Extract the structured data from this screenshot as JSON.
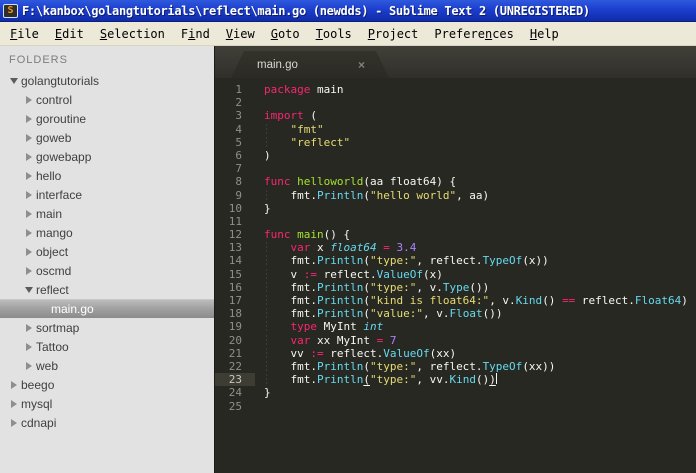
{
  "window": {
    "title": "F:\\kanbox\\golangtutorials\\reflect\\main.go (newdds) - Sublime Text 2 (UNREGISTERED)",
    "icon_glyph": "S"
  },
  "menu": {
    "items": [
      {
        "label": "File",
        "pre": "",
        "key": "F",
        "post": "ile"
      },
      {
        "label": "Edit",
        "pre": "",
        "key": "E",
        "post": "dit"
      },
      {
        "label": "Selection",
        "pre": "",
        "key": "S",
        "post": "election"
      },
      {
        "label": "Find",
        "pre": "F",
        "key": "i",
        "post": "nd"
      },
      {
        "label": "View",
        "pre": "",
        "key": "V",
        "post": "iew"
      },
      {
        "label": "Goto",
        "pre": "",
        "key": "G",
        "post": "oto"
      },
      {
        "label": "Tools",
        "pre": "",
        "key": "T",
        "post": "ools"
      },
      {
        "label": "Project",
        "pre": "",
        "key": "P",
        "post": "roject"
      },
      {
        "label": "Preferences",
        "pre": "Prefere",
        "key": "n",
        "post": "ces"
      },
      {
        "label": "Help",
        "pre": "",
        "key": "H",
        "post": "elp"
      }
    ]
  },
  "sidebar": {
    "header": "FOLDERS",
    "tree": [
      {
        "label": "golangtutorials",
        "level": 0,
        "state": "expanded",
        "selected": false
      },
      {
        "label": "control",
        "level": 1,
        "state": "collapsed",
        "selected": false
      },
      {
        "label": "goroutine",
        "level": 1,
        "state": "collapsed",
        "selected": false
      },
      {
        "label": "goweb",
        "level": 1,
        "state": "collapsed",
        "selected": false
      },
      {
        "label": "gowebapp",
        "level": 1,
        "state": "collapsed",
        "selected": false
      },
      {
        "label": "hello",
        "level": 1,
        "state": "collapsed",
        "selected": false
      },
      {
        "label": "interface",
        "level": 1,
        "state": "collapsed",
        "selected": false
      },
      {
        "label": "main",
        "level": 1,
        "state": "collapsed",
        "selected": false
      },
      {
        "label": "mango",
        "level": 1,
        "state": "collapsed",
        "selected": false
      },
      {
        "label": "object",
        "level": 1,
        "state": "collapsed",
        "selected": false
      },
      {
        "label": "oscmd",
        "level": 1,
        "state": "collapsed",
        "selected": false
      },
      {
        "label": "reflect",
        "level": 1,
        "state": "expanded",
        "selected": false
      },
      {
        "label": "main.go",
        "level": 2,
        "state": "file",
        "selected": true
      },
      {
        "label": "sortmap",
        "level": 1,
        "state": "collapsed",
        "selected": false
      },
      {
        "label": "Tattoo",
        "level": 1,
        "state": "collapsed",
        "selected": false
      },
      {
        "label": "web",
        "level": 1,
        "state": "collapsed",
        "selected": false
      },
      {
        "label": "beego",
        "level": 0,
        "state": "collapsed",
        "selected": false
      },
      {
        "label": "mysql",
        "level": 0,
        "state": "collapsed",
        "selected": false
      },
      {
        "label": "cdnapi",
        "level": 0,
        "state": "collapsed",
        "selected": false
      }
    ]
  },
  "tabs": [
    {
      "label": "main.go",
      "close_glyph": "×",
      "active": true
    }
  ],
  "editor": {
    "current_line": 23,
    "colors": {
      "background": "#272822",
      "keyword": "#f92672",
      "function": "#a6e22e",
      "string": "#e6db74",
      "type_italic": "#66d9ef",
      "call": "#66d9ef",
      "number": "#ae81ff",
      "text": "#f8f8f2",
      "gutter": "#8f908a"
    },
    "lines": [
      {
        "n": 1,
        "g": false,
        "tokens": [
          [
            "kw",
            "package"
          ],
          [
            "def",
            " main"
          ]
        ]
      },
      {
        "n": 2,
        "g": false,
        "tokens": []
      },
      {
        "n": 3,
        "g": false,
        "tokens": [
          [
            "kw",
            "import"
          ],
          [
            "def",
            " ("
          ]
        ]
      },
      {
        "n": 4,
        "g": true,
        "tokens": [
          [
            "def",
            "    "
          ],
          [
            "str",
            "\"fmt\""
          ]
        ]
      },
      {
        "n": 5,
        "g": true,
        "tokens": [
          [
            "def",
            "    "
          ],
          [
            "str",
            "\"reflect\""
          ]
        ]
      },
      {
        "n": 6,
        "g": false,
        "tokens": [
          [
            "def",
            ")"
          ]
        ]
      },
      {
        "n": 7,
        "g": false,
        "tokens": []
      },
      {
        "n": 8,
        "g": false,
        "tokens": [
          [
            "kw",
            "func"
          ],
          [
            "def",
            " "
          ],
          [
            "fn",
            "helloworld"
          ],
          [
            "def",
            "(aa float64) {"
          ]
        ]
      },
      {
        "n": 9,
        "g": true,
        "tokens": [
          [
            "def",
            "    fmt."
          ],
          [
            "call",
            "Println"
          ],
          [
            "def",
            "("
          ],
          [
            "str",
            "\"hello world\""
          ],
          [
            "def",
            ", aa)"
          ]
        ]
      },
      {
        "n": 10,
        "g": false,
        "tokens": [
          [
            "def",
            "}"
          ]
        ]
      },
      {
        "n": 11,
        "g": false,
        "tokens": []
      },
      {
        "n": 12,
        "g": false,
        "tokens": [
          [
            "kw",
            "func"
          ],
          [
            "def",
            " "
          ],
          [
            "fn",
            "main"
          ],
          [
            "def",
            "() {"
          ]
        ]
      },
      {
        "n": 13,
        "g": true,
        "tokens": [
          [
            "def",
            "    "
          ],
          [
            "kw",
            "var"
          ],
          [
            "def",
            " x "
          ],
          [
            "typ",
            "float64"
          ],
          [
            "def",
            " "
          ],
          [
            "kw",
            "="
          ],
          [
            "def",
            " "
          ],
          [
            "num",
            "3.4"
          ]
        ]
      },
      {
        "n": 14,
        "g": true,
        "tokens": [
          [
            "def",
            "    fmt."
          ],
          [
            "call",
            "Println"
          ],
          [
            "def",
            "("
          ],
          [
            "str",
            "\"type:\""
          ],
          [
            "def",
            ", reflect."
          ],
          [
            "call",
            "TypeOf"
          ],
          [
            "def",
            "(x))"
          ]
        ]
      },
      {
        "n": 15,
        "g": true,
        "tokens": [
          [
            "def",
            "    v "
          ],
          [
            "kw",
            ":="
          ],
          [
            "def",
            " reflect."
          ],
          [
            "call",
            "ValueOf"
          ],
          [
            "def",
            "(x)"
          ]
        ]
      },
      {
        "n": 16,
        "g": true,
        "tokens": [
          [
            "def",
            "    fmt."
          ],
          [
            "call",
            "Println"
          ],
          [
            "def",
            "("
          ],
          [
            "str",
            "\"type:\""
          ],
          [
            "def",
            ", v."
          ],
          [
            "call",
            "Type"
          ],
          [
            "def",
            "())"
          ]
        ]
      },
      {
        "n": 17,
        "g": true,
        "tokens": [
          [
            "def",
            "    fmt."
          ],
          [
            "call",
            "Println"
          ],
          [
            "def",
            "("
          ],
          [
            "str",
            "\"kind is float64:\""
          ],
          [
            "def",
            ", v."
          ],
          [
            "call",
            "Kind"
          ],
          [
            "def",
            "() "
          ],
          [
            "kw",
            "=="
          ],
          [
            "def",
            " reflect."
          ],
          [
            "call",
            "Float64"
          ],
          [
            "def",
            ")"
          ]
        ]
      },
      {
        "n": 18,
        "g": true,
        "tokens": [
          [
            "def",
            "    fmt."
          ],
          [
            "call",
            "Println"
          ],
          [
            "def",
            "("
          ],
          [
            "str",
            "\"value:\""
          ],
          [
            "def",
            ", v."
          ],
          [
            "call",
            "Float"
          ],
          [
            "def",
            "())"
          ]
        ]
      },
      {
        "n": 19,
        "g": true,
        "tokens": [
          [
            "def",
            "    "
          ],
          [
            "kw",
            "type"
          ],
          [
            "def",
            " MyInt "
          ],
          [
            "typ",
            "int"
          ]
        ]
      },
      {
        "n": 20,
        "g": true,
        "tokens": [
          [
            "def",
            "    "
          ],
          [
            "kw",
            "var"
          ],
          [
            "def",
            " xx MyInt "
          ],
          [
            "kw",
            "="
          ],
          [
            "def",
            " "
          ],
          [
            "num",
            "7"
          ]
        ]
      },
      {
        "n": 21,
        "g": true,
        "tokens": [
          [
            "def",
            "    vv "
          ],
          [
            "kw",
            ":="
          ],
          [
            "def",
            " reflect."
          ],
          [
            "call",
            "ValueOf"
          ],
          [
            "def",
            "(xx)"
          ]
        ]
      },
      {
        "n": 22,
        "g": true,
        "tokens": [
          [
            "def",
            "    fmt."
          ],
          [
            "call",
            "Println"
          ],
          [
            "def",
            "("
          ],
          [
            "str",
            "\"type:\""
          ],
          [
            "def",
            ", reflect."
          ],
          [
            "call",
            "TypeOf"
          ],
          [
            "def",
            "(xx))"
          ]
        ]
      },
      {
        "n": 23,
        "g": true,
        "tokens": [
          [
            "def",
            "    fmt."
          ],
          [
            "call",
            "Println"
          ],
          [
            "defu",
            "("
          ],
          [
            "str",
            "\"type:\""
          ],
          [
            "def",
            ", vv."
          ],
          [
            "call",
            "Kind"
          ],
          [
            "def",
            "()"
          ],
          [
            "defu",
            ")"
          ],
          [
            "cursor",
            ""
          ]
        ]
      },
      {
        "n": 24,
        "g": false,
        "tokens": [
          [
            "def",
            "}"
          ]
        ]
      },
      {
        "n": 25,
        "g": false,
        "tokens": []
      }
    ]
  }
}
